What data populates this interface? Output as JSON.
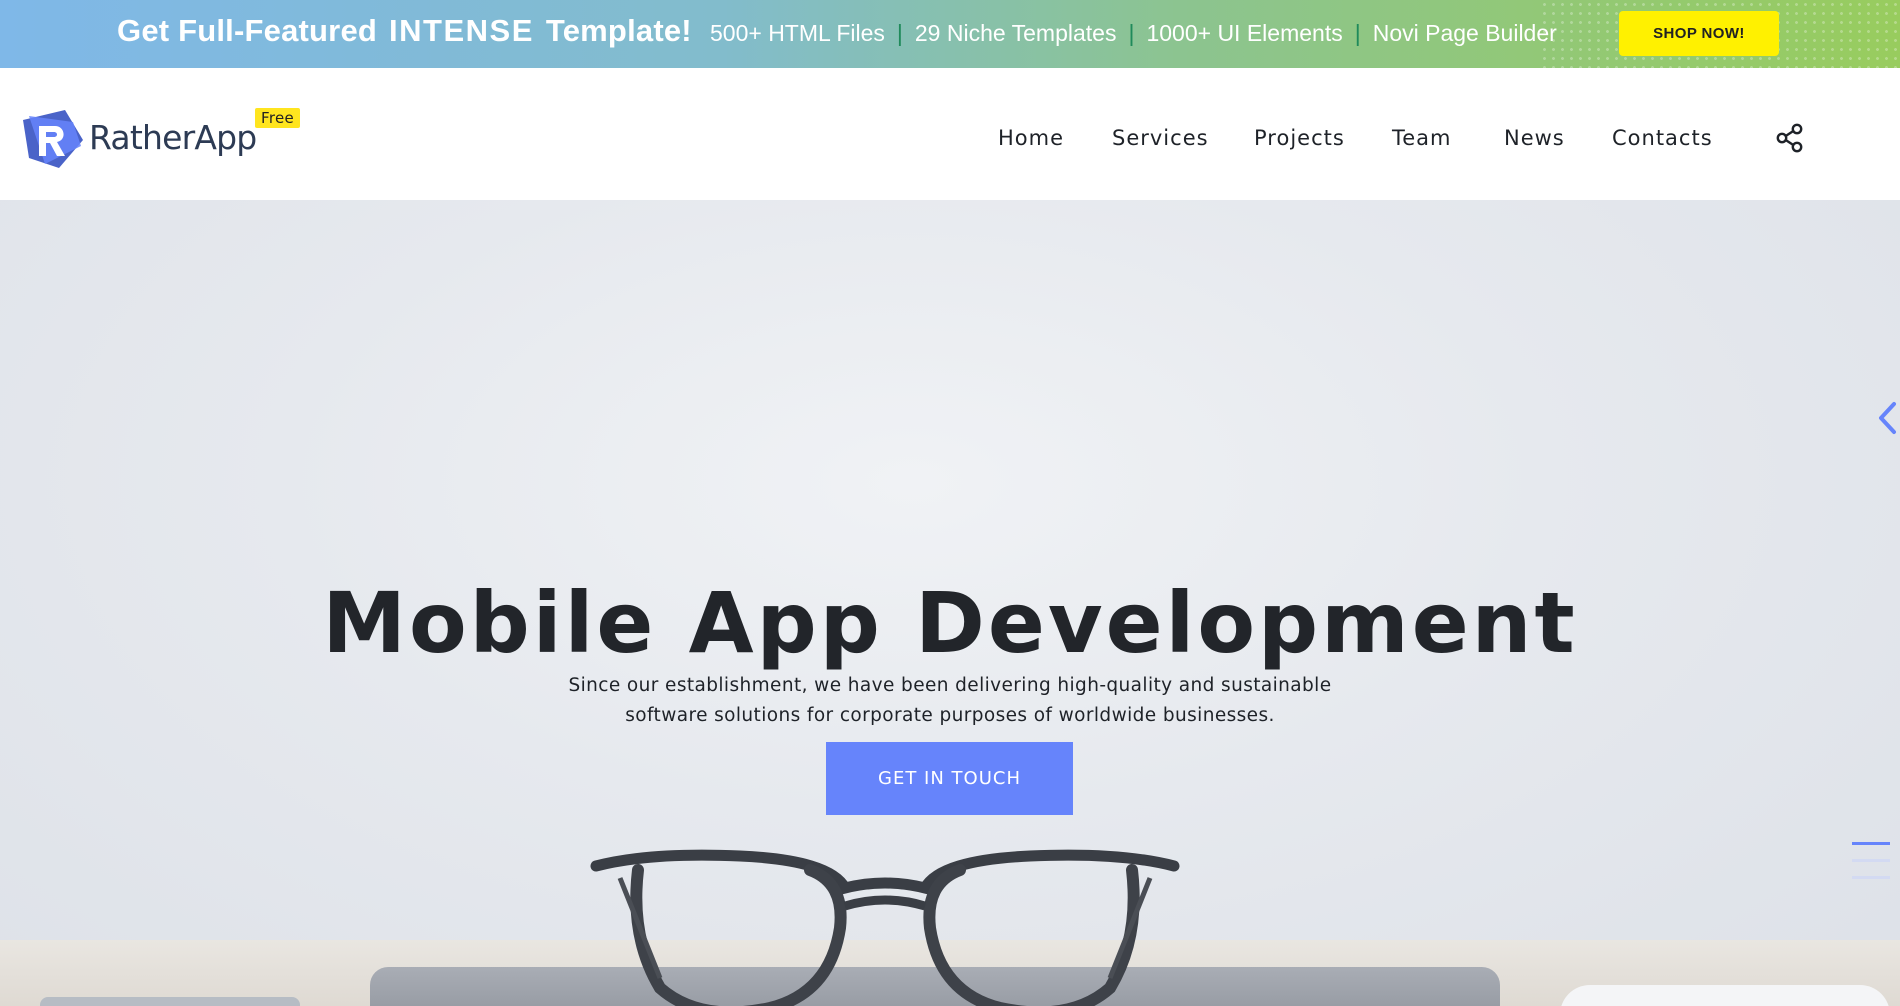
{
  "colors": {
    "accent": "#6684fb",
    "promo_button": "#fff100",
    "separator": "#1f8a5b",
    "logo_badge": "#ffe51f",
    "text_dark": "#22252a"
  },
  "promo": {
    "title_start": "Get Full-Featured",
    "title_highlight": "INTENSE",
    "title_end": "Template!",
    "features": [
      "500+ HTML Files",
      "29 Niche Templates",
      "1000+ UI Elements",
      "Novi Page Builder"
    ],
    "separator": "|",
    "button_label": "SHOP NOW!"
  },
  "header": {
    "logo_text": "RatherApp",
    "logo_badge": "Free",
    "logo_icon": "ratherapp-logo-icon",
    "nav": [
      "Home",
      "Services",
      "Projects",
      "Team",
      "News",
      "Contacts"
    ],
    "share_icon": "share-icon"
  },
  "hero": {
    "title": "Mobile App Development",
    "text_line1": "Since our establishment, we have been delivering high-quality and sustainable",
    "text_line2": "software solutions for corporate purposes of worldwide businesses.",
    "button_label": "GET IN TOUCH",
    "prev_icon": "chevron-left-icon",
    "slides": {
      "count": 3,
      "active": 1
    }
  }
}
